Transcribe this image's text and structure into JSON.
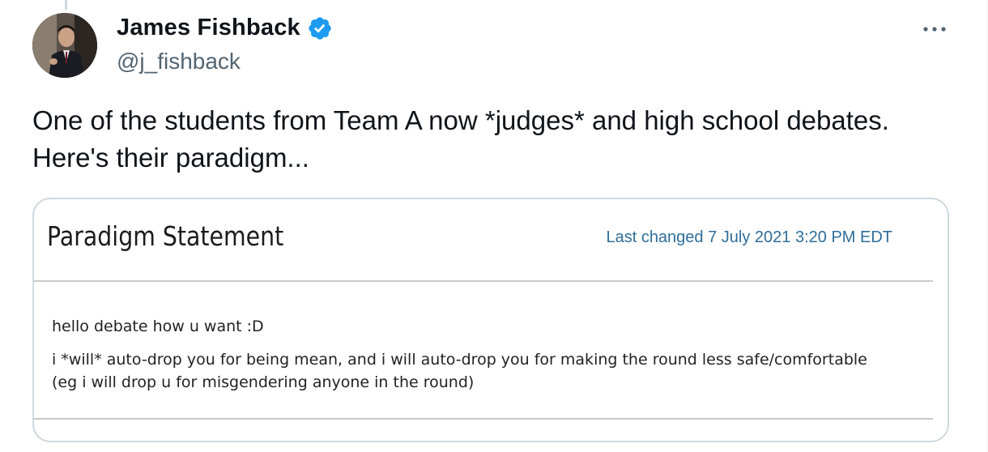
{
  "author": {
    "display_name": "James Fishback",
    "handle": "@j_fishback",
    "verified": true,
    "verified_color": "#1d9bf0",
    "avatar_icon": "profile-photo"
  },
  "menu": {
    "more_icon": "ellipsis-icon"
  },
  "tweet": {
    "text_line1": "One of the students from Team A now *judges* and high school debates.",
    "text_line2": "Here's their paradigm..."
  },
  "image": {
    "title": "Paradigm Statement",
    "last_changed": "Last changed 7 July 2021 3:20 PM EDT",
    "line1": "hello debate how u want :D",
    "line2": "i *will* auto-drop you for being mean, and i will auto-drop you for making the round less safe/comfortable",
    "line3": "(eg i will drop u for misgendering anyone in the round)",
    "accent_color": "#2f6e9a"
  }
}
